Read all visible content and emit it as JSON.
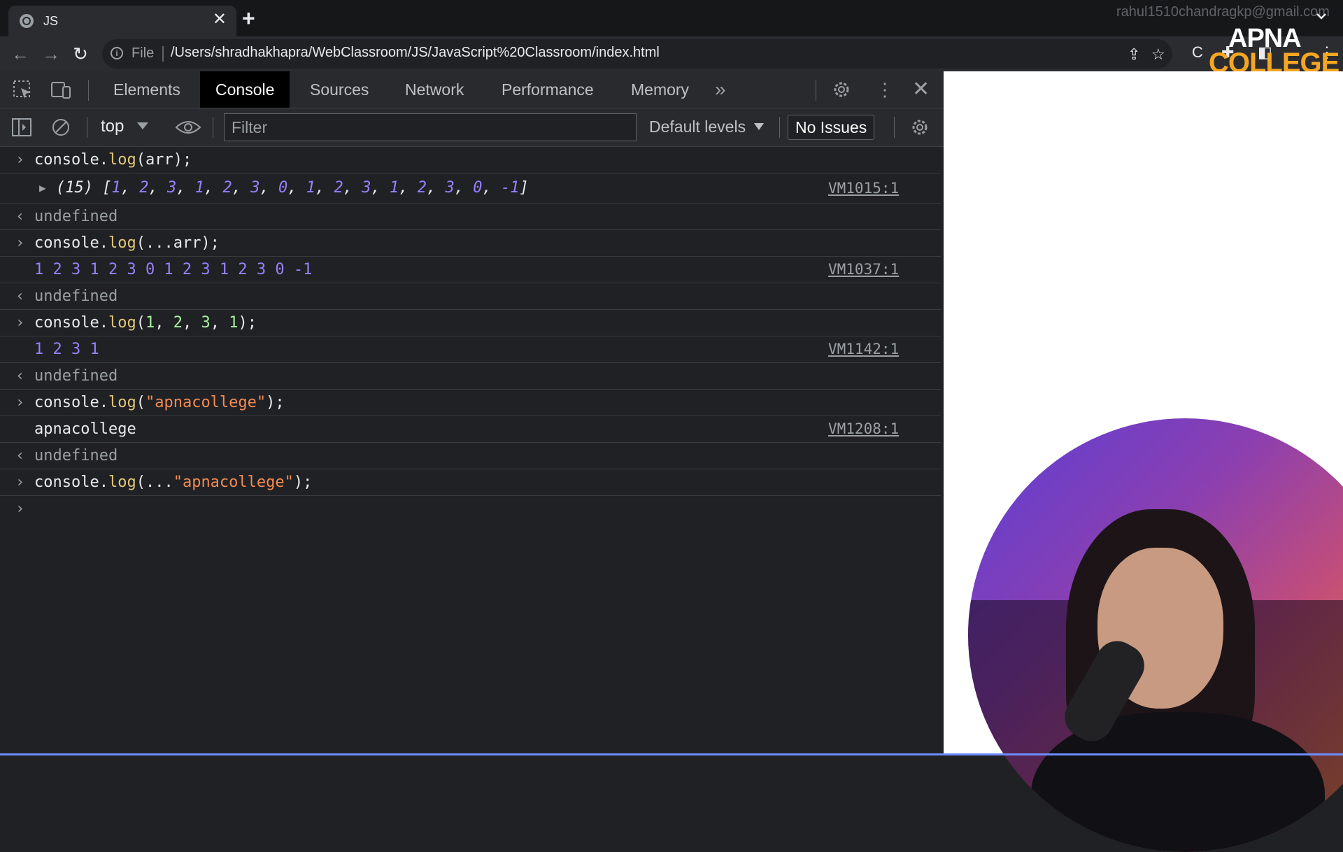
{
  "browser": {
    "tab_title": "JS",
    "tab_close": "✕",
    "new_tab": "+",
    "profile_email": "rahul1510chandragkp@gmail.com",
    "omnibox_scheme": "File",
    "url": "/Users/shradhakhapra/WebClassroom/JS/JavaScript%20Classroom/index.html"
  },
  "logo": {
    "top": "APNA",
    "bottom": "COLLEGE"
  },
  "devtools": {
    "tabs": [
      "Elements",
      "Console",
      "Sources",
      "Network",
      "Performance",
      "Memory"
    ],
    "active_tab": "Console",
    "context": "top",
    "filter_placeholder": "Filter",
    "levels": "Default levels",
    "issues": "No Issues"
  },
  "console": {
    "arr_length": "(15)",
    "arr_values": [
      "1",
      "2",
      "3",
      "1",
      "2",
      "3",
      "0",
      "1",
      "2",
      "3",
      "1",
      "2",
      "3",
      "0",
      "-1"
    ],
    "spread_output": "1 2 3 1 2 3 0 1 2 3 1 2 3 0 -1",
    "nums_output": "1 2 3 1",
    "str_output": "apnacollege",
    "undefined": "undefined",
    "sources": [
      "VM1015:1",
      "VM1037:1",
      "VM1142:1",
      "VM1208:1"
    ],
    "inputs": {
      "log_arr": {
        "obj": "console.",
        "fn": "log",
        "args": "(arr);"
      },
      "log_spread": {
        "obj": "console.",
        "fn": "log",
        "args": "(...arr);"
      },
      "log_nums": {
        "obj": "console.",
        "fn": "log",
        "open": "(",
        "n1": "1",
        "n2": "2",
        "n3": "3",
        "n4": "1",
        "close": ");"
      },
      "log_str": {
        "obj": "console.",
        "fn": "log",
        "open": "(",
        "str": "\"apnacollege\"",
        "close": ");"
      },
      "log_spread_str": {
        "obj": "console.",
        "fn": "log",
        "open": "(...",
        "str": "\"apnacollege\"",
        "close": ");"
      }
    }
  },
  "colors": {
    "keyword_fn": "#e3c77a",
    "number": "#9980ff",
    "string": "#f28b54",
    "literal_arg": "#a7f0a2",
    "prompt": "#4d7eff"
  }
}
